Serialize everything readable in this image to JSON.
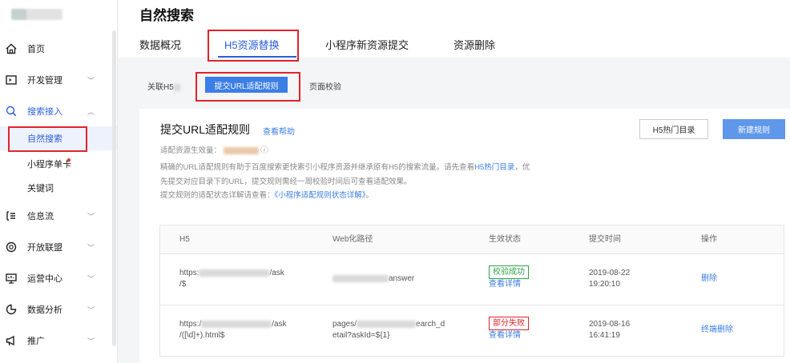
{
  "header": {
    "title": "自然搜索"
  },
  "tabs": [
    {
      "label": "数据概况"
    },
    {
      "label": "H5资源替换"
    },
    {
      "label": "小程序新资源提交"
    },
    {
      "label": "资源删除"
    }
  ],
  "sidebar": {
    "items": [
      {
        "label": "首页",
        "icon": "home-icon"
      },
      {
        "label": "开发管理",
        "icon": "dev-icon"
      },
      {
        "label": "搜索接入",
        "icon": "search-icon"
      },
      {
        "label": "自然搜索"
      },
      {
        "label": "小程序单卡"
      },
      {
        "label": "关键词"
      },
      {
        "label": "信息流",
        "icon": "feed-icon"
      },
      {
        "label": "开放联盟",
        "icon": "alliance-icon"
      },
      {
        "label": "运营中心",
        "icon": "monitor-icon"
      },
      {
        "label": "数据分析",
        "icon": "chart-icon"
      },
      {
        "label": "推广",
        "icon": "megaphone-icon"
      }
    ]
  },
  "subtabs": {
    "link_h5": "关联H5",
    "submit": "提交URL适配规则",
    "verify": "页面校验"
  },
  "card": {
    "title": "提交URL适配规则",
    "help": "查看帮助",
    "btn_directory": "H5热门目录",
    "btn_new_rule": "新建规则",
    "quota_label": "适配资源生效量：",
    "desc1": "精确的URL适配规则有助于百度搜索更快索引小程序资源并继承原有H5的搜索流量。请先查看",
    "desc1_link": "H5热门目录",
    "desc1_tail": "，优",
    "desc2": "先提交对应目录下的URL，提交规则需经一周校验时间后可查看适配效果。",
    "desc3": "提交规则的适配状态详解请查看：",
    "desc3_link": "《小程序适配规则状态详解》",
    "desc3_tail": "。"
  },
  "table": {
    "columns": [
      "H5",
      "Web化路径",
      "生效状态",
      "提交时间",
      "操作"
    ],
    "rows": [
      {
        "h5_a": "https:",
        "h5_b": "/ask",
        "h5_c": "/$",
        "web_a": "answer",
        "web_b": "",
        "status": "校验成功",
        "detail": "查看详情",
        "date": "2019-08-22",
        "time": "19:20:10",
        "action": "删除"
      },
      {
        "h5_a": "https:/",
        "h5_b": "/ask",
        "h5_c": "/([\\d]+).html$",
        "web_a": "pages/",
        "web_a2": "earch_d",
        "web_b": "etail?askId=${1}",
        "status": "部分失败",
        "detail": "查看详情",
        "date": "2019-08-16",
        "time": "16:41:19",
        "action": "终端删除"
      }
    ]
  }
}
